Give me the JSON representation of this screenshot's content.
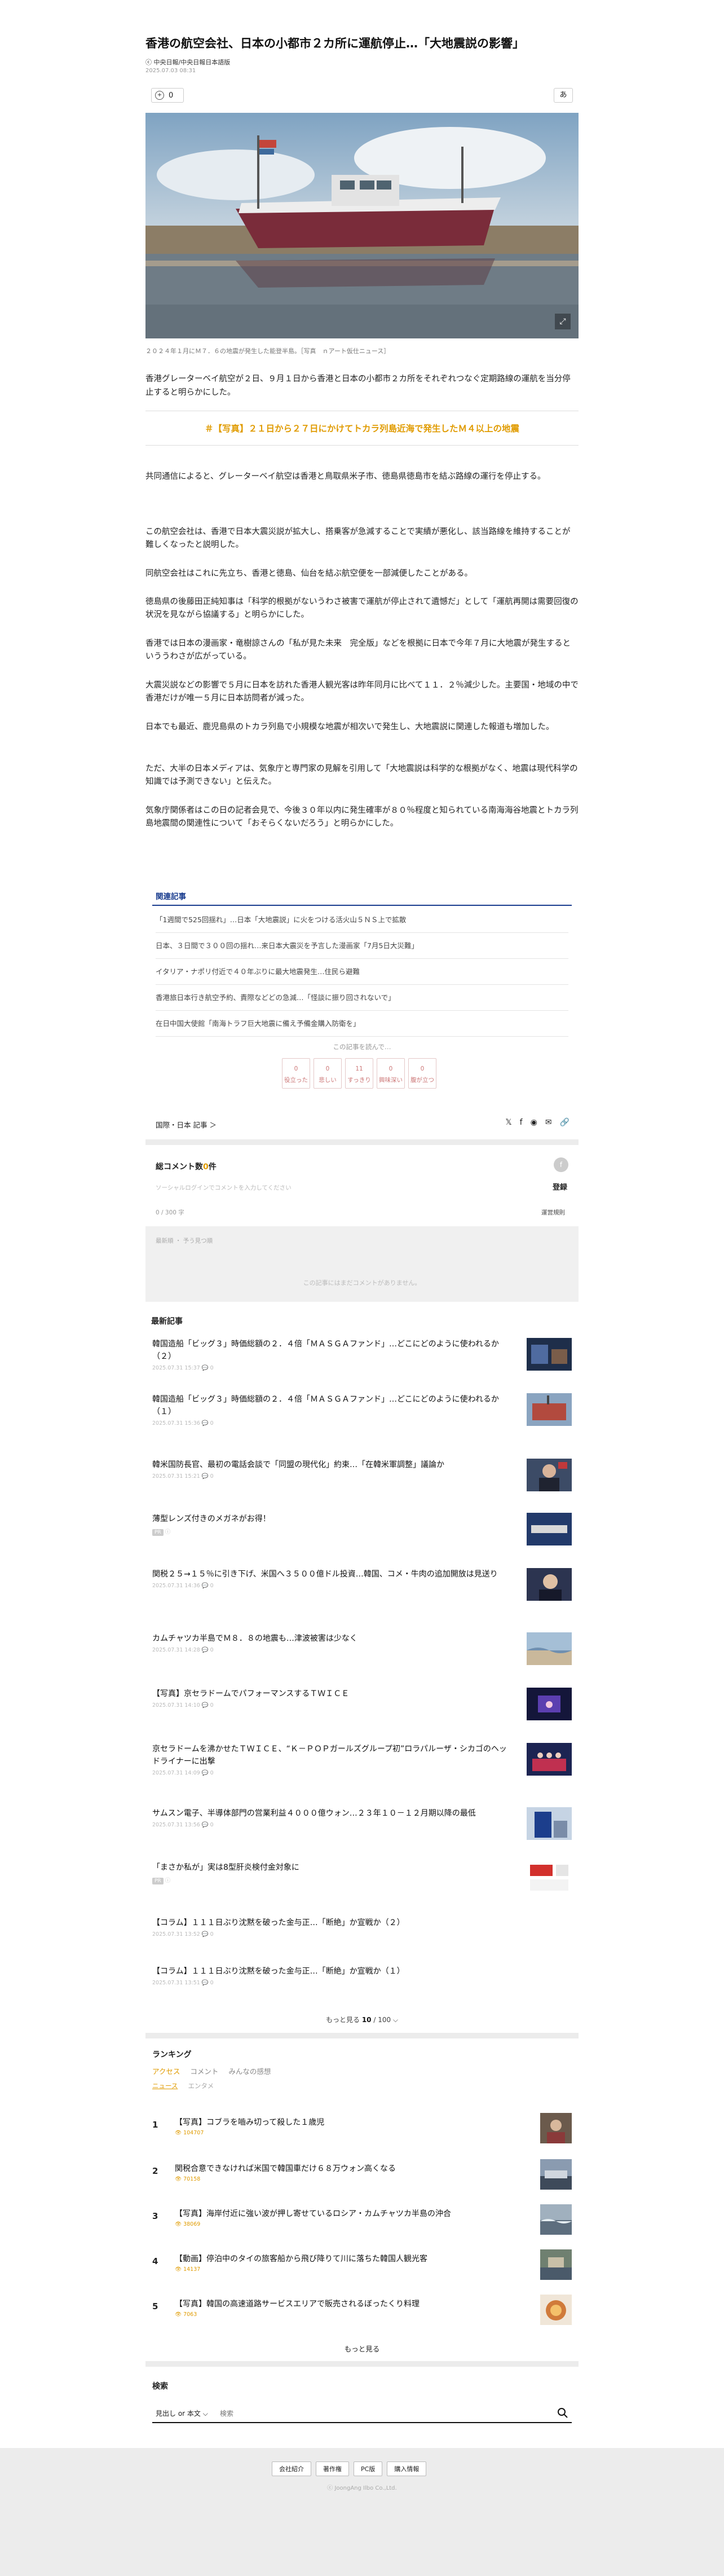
{
  "article": {
    "title": "香港の航空会社、日本の小都市２カ所に運航停止…「大地震説の影響」",
    "byline": "ⓒ 中央日報/中央日報日本語版",
    "date": "2025.07.03 08:31",
    "like_count": "0",
    "font_button": "あ",
    "caption": "２０２４年１月にＭ７．６の地震が発生した能登半島。［写真　ｎアート仮仕ニュース］",
    "lead": "香港グレーターベイ航空が２日、９月１日から香港と日本の小都市２カ所をそれぞれつなぐ定期路線の運航を当分停止すると明らかにした。",
    "highlight": "＃【写真】２１日から２７日にかけてトカラ列島近海で発生したＭ４以上の地震",
    "paragraphs": [
      "共同通信によると、グレーターベイ航空は香港と鳥取県米子市、徳島県徳島市を結ぶ路線の運行を停止する。",
      "この航空会社は、香港で日本大震災説が拡大し、搭乗客が急減することで実績が悪化し、該当路線を維持することが難しくなったと説明した。",
      "同航空会社はこれに先立ち、香港と徳島、仙台を結ぶ航空便を一部減便したことがある。",
      "徳島県の後藤田正純知事は「科学的根拠がないうわさ被害で運航が停止されて遺憾だ」として「運航再開は需要回復の状況を見ながら協議する」と明らかにした。",
      "香港では日本の漫画家・竜樹諒さんの「私が見た未来　完全版」などを根拠に日本で今年７月に大地震が発生するといううわさが広がっている。",
      "大震災説などの影響で５月に日本を訪れた香港人観光客は昨年同月に比べて１１．２％減少した。主要国・地域の中で香港だけが唯一５月に日本訪問者が減った。",
      "日本でも最近、鹿児島県のトカラ列島で小規模な地震が相次いで発生し、大地震説に関連した報道も増加した。",
      "ただ、大半の日本メディアは、気象庁と専門家の見解を引用して「大地震説は科学的な根拠がなく、地震は現代科学の知識では予測できない」と伝えた。",
      "気象庁関係者はこの日の記者会見で、今後３０年以内に発生確率が８０％程度と知られている南海海谷地震とトカラ列島地震間の関連性について「おそらくないだろう」と明らかにした。"
    ]
  },
  "related": {
    "heading": "関連記事",
    "items": [
      "「1週間で525回揺れ」…日本「大地震説」に火をつける活火山５ＮＳ上で拡散",
      "日本、３日間で３００回の揺れ…来日本大震災を予言した漫画家「7月5日大災難」",
      "イタリア・ナポリ付近で４０年ぶりに最大地震発生…住民ら避難",
      "香港旅日本行き航空予約、責際などどの急減…「怪談に振り回されないで」",
      "在日中国大使館「南海トラフ巨大地震に備え予備金購入防衛を」"
    ]
  },
  "reactions": {
    "label": "この記事を読んで…",
    "items": [
      {
        "count": "0",
        "label": "役立った"
      },
      {
        "count": "0",
        "label": "悲しい"
      },
      {
        "count": "11",
        "label": "すっきり"
      },
      {
        "count": "0",
        "label": "興味深い"
      },
      {
        "count": "0",
        "label": "腹が立つ"
      }
    ]
  },
  "category": {
    "label": "国際・日本 記事 ＞"
  },
  "comments": {
    "title_prefix": "総コメント数",
    "title_count": "0",
    "title_suffix": "件",
    "placeholder": "ソーシャルログインでコメントを入力してください",
    "login": "登録",
    "counter": "0 / 300 字",
    "terms": "運営規則",
    "sort": "最新順 ・ 予う見つ順",
    "empty": "この記事にはまだコメントがありません。"
  },
  "latest": {
    "heading": "最新記事",
    "items": [
      {
        "title": "韓国造船「ビッグ３」時価総額の２．４倍「ＭＡＳＧＡファンド」…どこにどのように使われるか（２）",
        "meta": "2025.07.31 15:37",
        "pr": ""
      },
      {
        "title": "韓国造船「ビッグ３」時価総額の２．４倍「ＭＡＳＧＡファンド」…どこにどのように使われるか（１）",
        "meta": "2025.07.31 15:36",
        "pr": ""
      },
      {
        "title": "韓米国防長官、最初の電話会談で「同盟の現代化」約束…「在韓米軍調整」議論か",
        "meta": "2025.07.31 15:21",
        "pr": ""
      },
      {
        "title": "薄型レンズ付きのメガネがお得！",
        "meta": "",
        "pr": "PR"
      },
      {
        "title": "関税２５→１５％に引き下げ、米国へ３５００億ドル投資…韓国、コメ・牛肉の追加開放は見送り",
        "meta": "2025.07.31 14:36",
        "pr": ""
      },
      {
        "title": "カムチャツカ半島でＭ８．８の地震も…津波被害は少なく",
        "meta": "2025.07.31 14:28",
        "pr": ""
      },
      {
        "title": "【写真】京セラドームでパフォーマンスするＴＷＩＣＥ",
        "meta": "2025.07.31 14:10",
        "pr": ""
      },
      {
        "title": "京セラドームを沸かせたＴＷＩＣＥ、“Ｋ－ＰＯＰガールズグループ初”ロラパルーザ・シカゴのヘッドライナーに出撃",
        "meta": "2025.07.31 14:09",
        "pr": ""
      },
      {
        "title": "サムスン電子、半導体部門の営業利益４０００億ウォン…２３年１０－１２月期以降の最低",
        "meta": "2025.07.31 13:56",
        "pr": ""
      },
      {
        "title": "「まさか私が」実は8型肝炎検付金対象に",
        "meta": "",
        "pr": "PR"
      },
      {
        "title": "【コラム】１１１日ぶり沈黙を破った金与正…「断絶」か宣戦か（２）",
        "meta": "2025.07.31 13:52",
        "pr": ""
      },
      {
        "title": "【コラム】１１１日ぶり沈黙を破った金与正…「断絶」か宣戦か（１）",
        "meta": "2025.07.31 13:51",
        "pr": ""
      }
    ],
    "more_prefix": "もっと見る ",
    "more_count": "10",
    "more_suffix": " / 100 ⌵"
  },
  "ranking": {
    "heading": "ランキング",
    "tabs": [
      "アクセス",
      "コメント",
      "みんなの感想"
    ],
    "subtabs": [
      "ニュース",
      "エンタメ"
    ],
    "items": [
      {
        "no": "1",
        "title": "【写真】コブラを嚙み切って殺した１歳児",
        "views": "104707"
      },
      {
        "no": "2",
        "title": "関税合意できなければ米国で韓国車だけ６８万ウォン高くなる",
        "views": "70158"
      },
      {
        "no": "3",
        "title": "【写真】海岸付近に強い波が押し寄せているロシア・カムチャツカ半島の沖合",
        "views": "38069"
      },
      {
        "no": "4",
        "title": "【動画】停泊中のタイの旅客船から飛び降りて川に落ちた韓国人観光客",
        "views": "14137"
      },
      {
        "no": "5",
        "title": "【写真】韓国の高速道路サービスエリアで販売されるぼったくり料理",
        "views": "7063"
      }
    ],
    "more": "もっと見る"
  },
  "search": {
    "heading": "検索",
    "scope": "見出し or 本文 ⌵",
    "placeholder": "検索"
  },
  "footer": {
    "links": [
      "会社紹介",
      "著作権",
      "PC版",
      "購入情報"
    ],
    "copyright": "ⓒ JoongAng Ilbo Co.,Ltd."
  }
}
